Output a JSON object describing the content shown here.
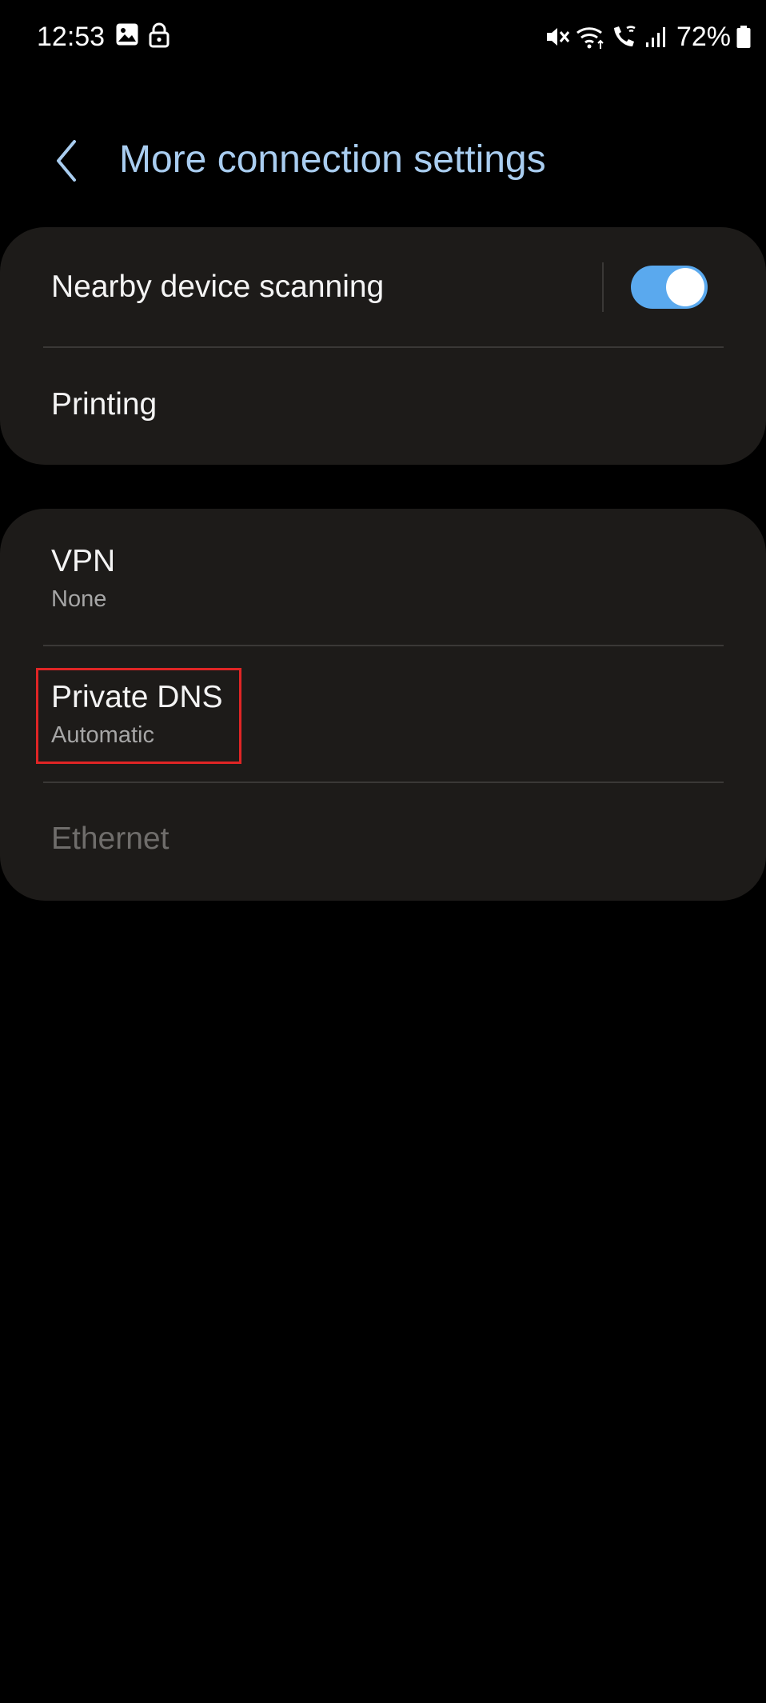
{
  "status_bar": {
    "time": "12:53",
    "left_icons": [
      "gallery-icon",
      "lock-icon"
    ],
    "right_icons": [
      "vibrate-mute-icon",
      "wifi-icon",
      "wifi-calling-icon",
      "signal-icon",
      "battery-icon"
    ],
    "battery_percent": "72%"
  },
  "header": {
    "title": "More connection settings"
  },
  "group_1": {
    "nearby_scanning": {
      "label": "Nearby device scanning",
      "toggle_on": true
    },
    "printing": {
      "label": "Printing"
    }
  },
  "group_2": {
    "vpn": {
      "label": "VPN",
      "value": "None"
    },
    "private_dns": {
      "label": "Private DNS",
      "value": "Automatic"
    },
    "ethernet": {
      "label": "Ethernet",
      "disabled": true
    }
  },
  "colors": {
    "background": "#000000",
    "card": "#1d1b19",
    "title_accent": "#a9cdf0",
    "toggle_on": "#5aa9ee",
    "highlight": "#e02525",
    "disabled_text": "#6f6d6b"
  }
}
